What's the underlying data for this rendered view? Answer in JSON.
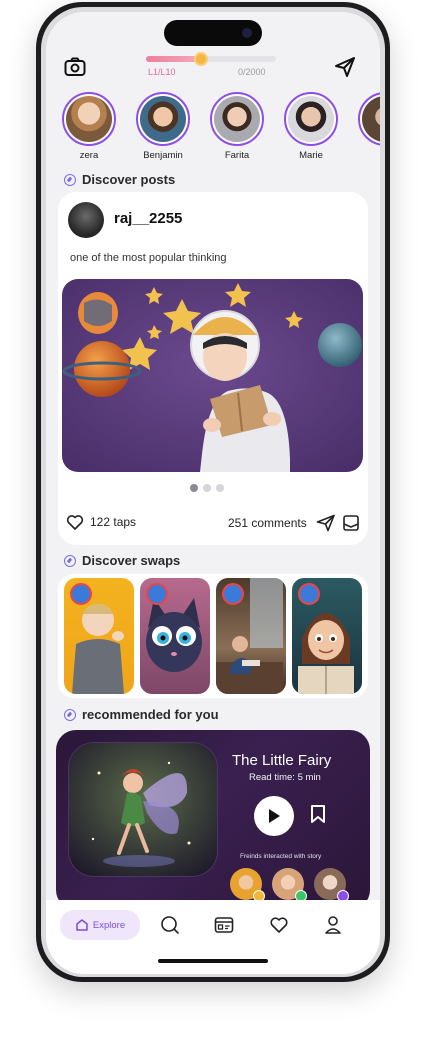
{
  "header": {
    "level_label": "L1/L10",
    "points_label": "0/2000",
    "progress": 0.4
  },
  "stories": [
    {
      "name": "zera"
    },
    {
      "name": "Benjamin"
    },
    {
      "name": "Farita"
    },
    {
      "name": "Marie"
    },
    {
      "name": ""
    }
  ],
  "discover_posts": {
    "title": "Discover posts",
    "post": {
      "username": "raj__2255",
      "caption": "one of the most popular thinking",
      "taps": "122 taps",
      "comments": "251 comments",
      "carousel_pages": 3,
      "carousel_active": 1
    }
  },
  "discover_swaps": {
    "title": "Discover swaps"
  },
  "recommended": {
    "title": "recommended for you",
    "story_title": "The Little Fairy",
    "read_time": "Read time: 5 min",
    "friends_label": "Freinds interacted with story"
  },
  "nav": {
    "explore_label": "Explore"
  },
  "colors": {
    "accent": "#8c4de8",
    "progress": "#f07e9c",
    "nav_active_bg": "#efe6fb"
  }
}
